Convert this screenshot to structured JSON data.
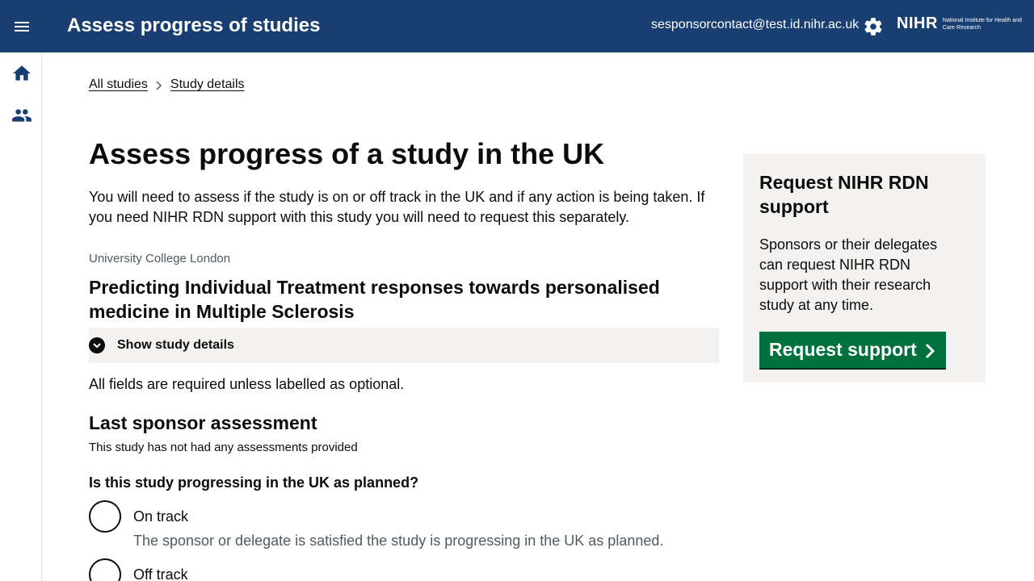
{
  "header": {
    "title": "Assess progress of studies",
    "user_email": "sesponsorcontact@test.id.nihr.ac.uk",
    "brand_mark": "NIHR",
    "brand_subtitle": "National Institute for Health and Care Research",
    "background": "#193e72"
  },
  "sidenav": {
    "items": [
      {
        "icon": "home-icon"
      },
      {
        "icon": "users-icon"
      }
    ]
  },
  "breadcrumb": {
    "items": [
      "All studies",
      "Study details"
    ]
  },
  "main": {
    "title": "Assess progress of a study in the UK",
    "intro": "You will need to assess if the study is on or off track in the UK and if any action is being taken. If you need NIHR RDN support with this study you will need to request this separately.",
    "organisation": "University College London",
    "study_title": "Predicting Individual Treatment responses towards personalised medicine in Multiple Sclerosis",
    "show_details_label": "Show study details",
    "required_note": "All fields are required unless labelled as optional.",
    "last_assessment_heading": "Last sponsor assessment",
    "last_assessment_text": "This study has not had any assessments provided",
    "question": "Is this study progressing in the UK as planned?",
    "options": [
      {
        "label": "On track",
        "hint": "The sponsor or delegate is satisfied the study is progressing in the UK as planned."
      },
      {
        "label": "Off track",
        "hint": ""
      }
    ]
  },
  "aside": {
    "title": "Request NIHR RDN support",
    "body": "Sponsors or their delegates can request NIHR RDN support with their research study at any time.",
    "button_label": "Request support",
    "button_color": "#00703c"
  }
}
